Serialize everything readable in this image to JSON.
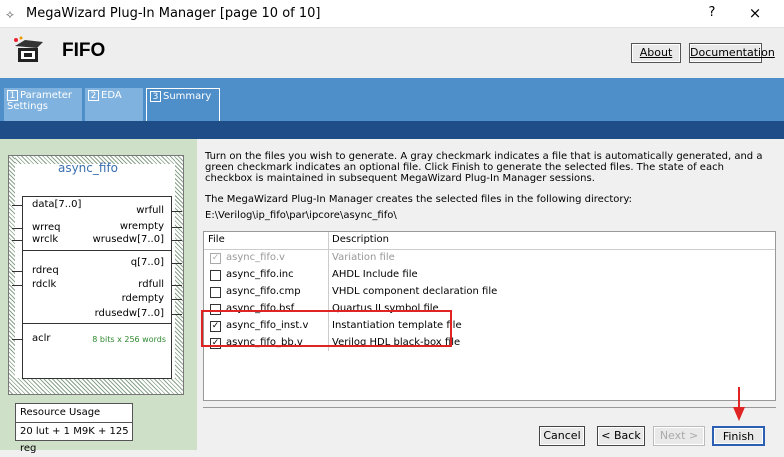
{
  "window": {
    "title": "MegaWizard Plug-In Manager [page 10 of 10]",
    "help": "?",
    "close": "×"
  },
  "header": {
    "title": "FIFO",
    "about": "About",
    "documentation": "Documentation"
  },
  "tabs": [
    {
      "num": "1",
      "label": "Parameter Settings"
    },
    {
      "num": "2",
      "label": "EDA"
    },
    {
      "num": "3",
      "label": "Summary"
    }
  ],
  "symbol": {
    "name": "async_fifo",
    "group1_left": [
      "data[7..0]",
      "wrreq",
      "wrclk"
    ],
    "group1_right": [
      "wrfull",
      "wrempty",
      "wrusedw[7..0]"
    ],
    "group2_left": [
      "rdreq",
      "rdclk"
    ],
    "group2_right": [
      "q[7..0]",
      "rdfull",
      "rdempty",
      "rdusedw[7..0]"
    ],
    "group3_left": [
      "aclr"
    ],
    "size_note": "8 bits x 256 words"
  },
  "resource": {
    "title": "Resource Usage",
    "value": "20 lut + 1 M9K + 125 reg"
  },
  "summary": {
    "intro": "Turn on the files you wish to generate. A gray checkmark indicates a file that is automatically generated, and a green checkmark indicates an optional file. Click Finish to generate the selected files. The state of each checkbox is maintained in subsequent MegaWizard Plug-In Manager sessions.",
    "directory_label": "The MegaWizard Plug-In Manager creates the selected files in the following directory:",
    "directory": "E:\\Verilog\\ip_fifo\\par\\ipcore\\async_fifo\\",
    "col_file": "File",
    "col_description": "Description",
    "files": [
      {
        "name": "async_fifo.v",
        "description": "Variation file",
        "state": "gray"
      },
      {
        "name": "async_fifo.inc",
        "description": "AHDL Include file",
        "state": "unchecked"
      },
      {
        "name": "async_fifo.cmp",
        "description": "VHDL component declaration file",
        "state": "unchecked"
      },
      {
        "name": "async_fifo.bsf",
        "description": "Quartus II symbol file",
        "state": "unchecked"
      },
      {
        "name": "async_fifo_inst.v",
        "description": "Instantiation template file",
        "state": "checked"
      },
      {
        "name": "async_fifo_bb.v",
        "description": "Verilog HDL black-box file",
        "state": "checked"
      }
    ]
  },
  "buttons": {
    "cancel": "Cancel",
    "back": "< Back",
    "next": "Next >",
    "finish": "Finish"
  },
  "colors": {
    "tabbar": "#4e8ec9",
    "navy": "#1e4d87",
    "highlight": "#e02424",
    "leftpane": "#cfe0c8"
  }
}
